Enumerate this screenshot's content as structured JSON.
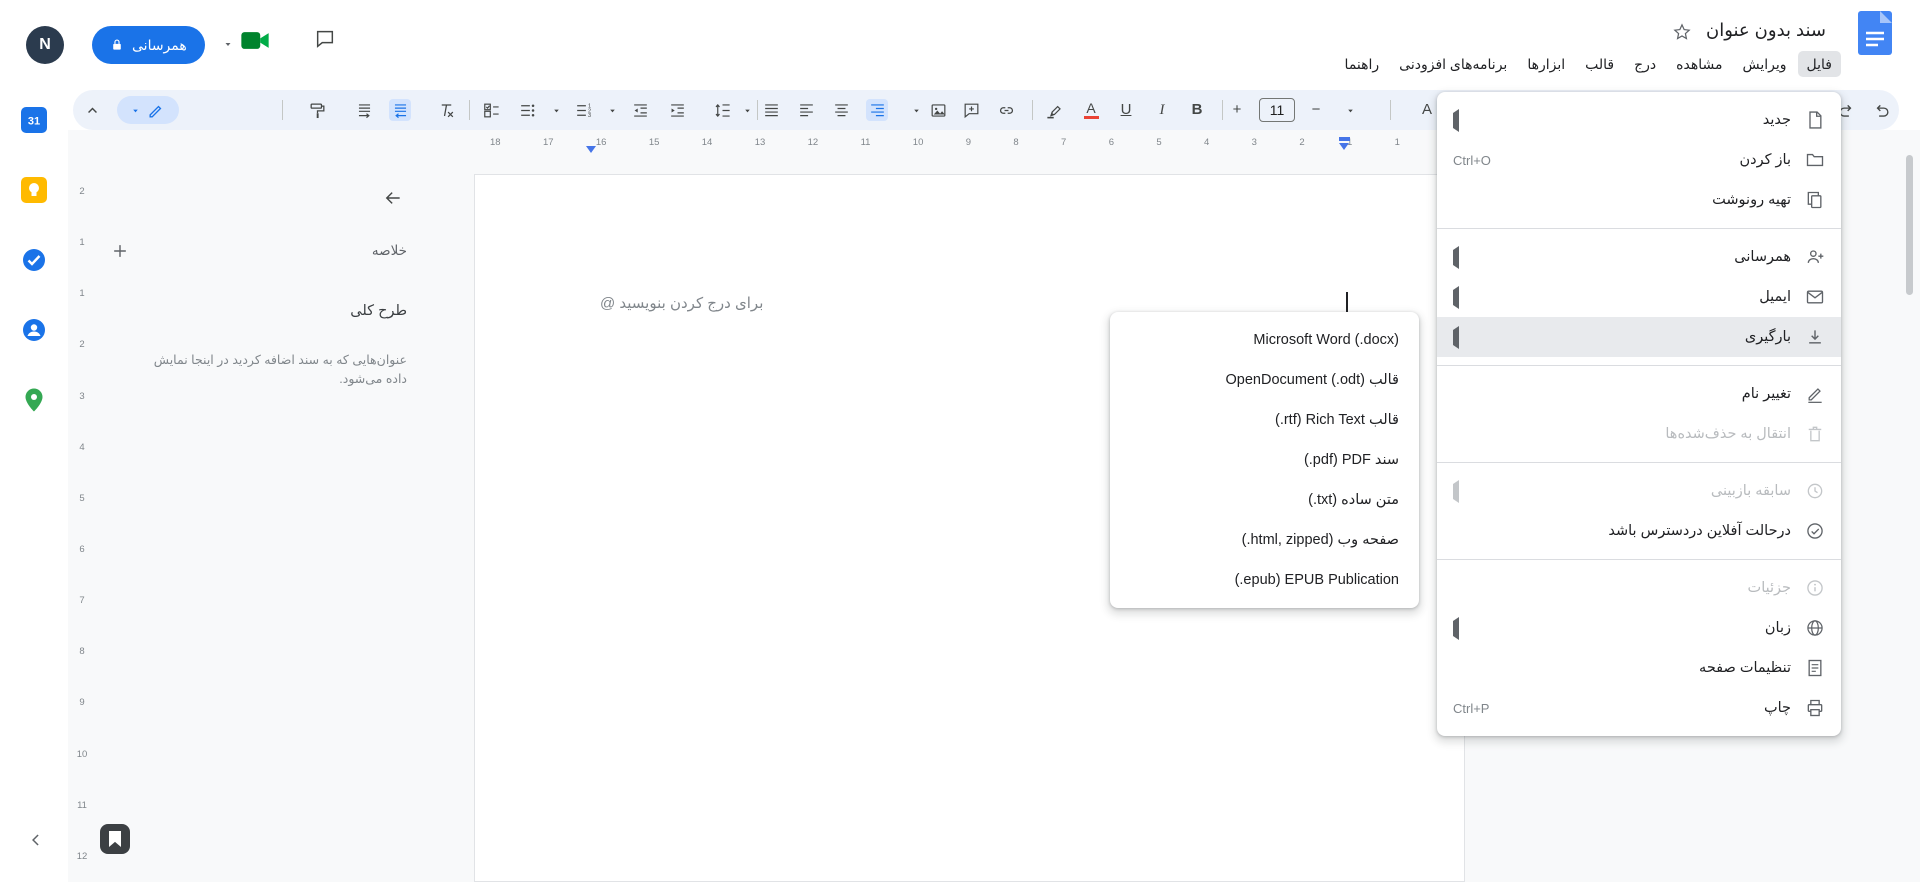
{
  "header": {
    "doc_title": "سند بدون عنوان",
    "menubar": [
      "فایل",
      "ویرایش",
      "مشاهده",
      "درج",
      "قالب",
      "ابزارها",
      "برنامه‌های افزودنی",
      "راهنما"
    ],
    "share_label": "همرسانی",
    "avatar_letter": "N"
  },
  "toolbar": {
    "font_size": "11",
    "font_name_partial": "A"
  },
  "rulers": {
    "horizontal": [
      "18",
      "17",
      "16",
      "15",
      "14",
      "13",
      "12",
      "11",
      "10",
      "9",
      "8",
      "7",
      "6",
      "5",
      "4",
      "3",
      "2",
      "1",
      "1"
    ],
    "vertical": [
      "2",
      "1",
      "1",
      "2",
      "3",
      "4",
      "5",
      "6",
      "7",
      "8",
      "9",
      "10",
      "11",
      "12"
    ]
  },
  "tabs_panel": {
    "summary_label": "خلاصه",
    "outline_label": "طرح کلی",
    "empty_hint_line1": "عنوان‌هایی که به سند اضافه کردید در اینجا نمایش",
    "empty_hint_line2": "داده می‌شود."
  },
  "editor": {
    "type_hint": "برای درج کردن بنویسید @"
  },
  "file_menu": {
    "items": [
      {
        "label": "جدید"
      },
      {
        "label": "باز کردن",
        "shortcut": "Ctrl+O"
      },
      {
        "label": "تهیه رونوشت"
      },
      {
        "label": "همرسانی"
      },
      {
        "label": "ایمیل"
      },
      {
        "label": "بارگیری"
      },
      {
        "label": "تغییر نام"
      },
      {
        "label": "انتقال به حذف‌شده‌ها"
      },
      {
        "label": "سابقه بازبینی"
      },
      {
        "label": "درحالت آفلاین دردسترس باشد"
      },
      {
        "label": "جزئیات"
      },
      {
        "label": "زبان"
      },
      {
        "label": "تنظیمات صفحه"
      },
      {
        "label": "چاپ",
        "shortcut": "Ctrl+P"
      }
    ]
  },
  "download_submenu": {
    "items": [
      "Microsoft Word (.docx)",
      "OpenDocument (.odt) قالب",
      "(.rtf) Rich Text قالب",
      "(.pdf) PDF سند",
      "(.txt) متن ساده",
      "(.html, zipped) صفحه وب",
      "(.epub) EPUB Publication"
    ]
  },
  "sidebar": {
    "calendar_day": "31"
  },
  "colors": {
    "accent_blue": "#1a73e8",
    "toolbar_bg": "#edf2fa",
    "canvas_bg": "#f8f9fa",
    "text_color_bar": "#ea4335"
  }
}
